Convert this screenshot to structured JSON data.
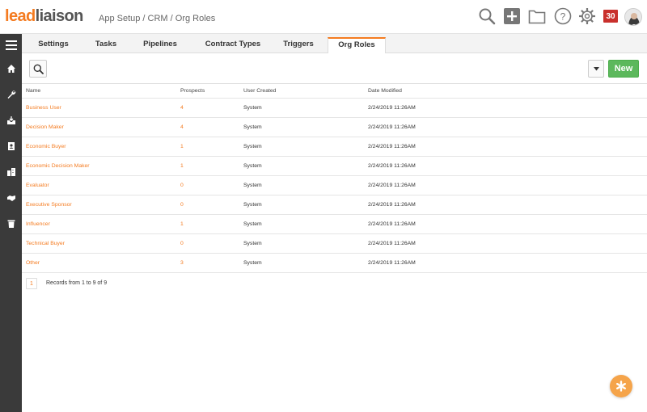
{
  "brand": {
    "logo_part1": "lead",
    "logo_part2": "liaison",
    "accent": "#f47b20"
  },
  "breadcrumb": "App Setup / CRM / Org Roles",
  "header": {
    "icons": [
      "search-icon",
      "add-icon",
      "folder-icon",
      "help-icon",
      "gear-icon"
    ],
    "notification_count": "30"
  },
  "sidebar": {
    "icons": [
      "menu-icon",
      "home-icon",
      "wrench-icon",
      "inbox-icon",
      "contacts-icon",
      "building-icon",
      "handshake-icon",
      "trash-icon"
    ]
  },
  "tabs": [
    {
      "label": "Settings"
    },
    {
      "label": "Tasks"
    },
    {
      "label": "Pipelines"
    },
    {
      "label": "Contract Types"
    },
    {
      "label": "Triggers"
    },
    {
      "label": "Org Roles",
      "active": true
    }
  ],
  "toolbar": {
    "new_label": "New"
  },
  "table": {
    "columns": [
      "Name",
      "Prospects",
      "User Created",
      "Date Modified"
    ],
    "rows": [
      {
        "name": "Business User",
        "prospects": "4",
        "user_created": "System",
        "date_modified": "2/24/2019 11:26AM"
      },
      {
        "name": "Decision Maker",
        "prospects": "4",
        "user_created": "System",
        "date_modified": "2/24/2019 11:26AM"
      },
      {
        "name": "Economic Buyer",
        "prospects": "1",
        "user_created": "System",
        "date_modified": "2/24/2019 11:26AM"
      },
      {
        "name": "Economic Decision Maker",
        "prospects": "1",
        "user_created": "System",
        "date_modified": "2/24/2019 11:26AM"
      },
      {
        "name": "Evaluator",
        "prospects": "0",
        "user_created": "System",
        "date_modified": "2/24/2019 11:26AM"
      },
      {
        "name": "Executive Sponsor",
        "prospects": "0",
        "user_created": "System",
        "date_modified": "2/24/2019 11:26AM"
      },
      {
        "name": "Influencer",
        "prospects": "1",
        "user_created": "System",
        "date_modified": "2/24/2019 11:26AM"
      },
      {
        "name": "Technical Buyer",
        "prospects": "0",
        "user_created": "System",
        "date_modified": "2/24/2019 11:26AM"
      },
      {
        "name": "Other",
        "prospects": "3",
        "user_created": "System",
        "date_modified": "2/24/2019 11:26AM"
      }
    ]
  },
  "pagination": {
    "current_page": "1",
    "records_text": "Records from 1 to 9 of 9"
  }
}
